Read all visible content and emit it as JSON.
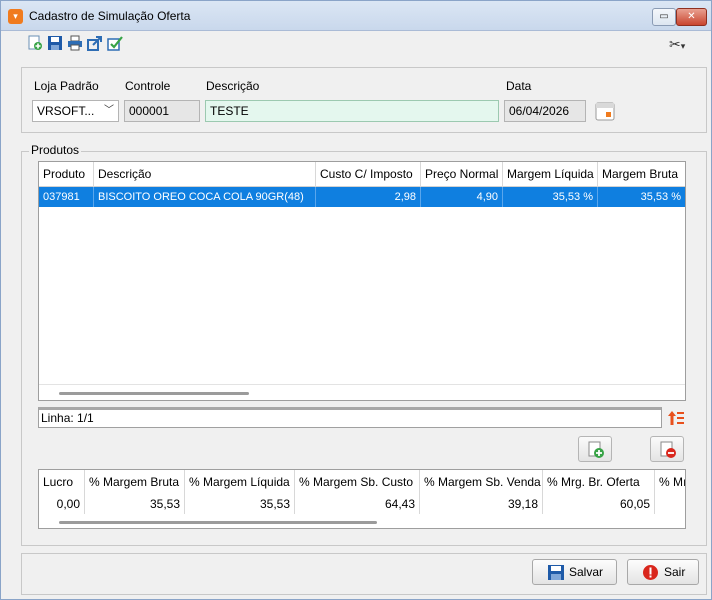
{
  "window": {
    "title": "Cadastro de Simulação Oferta",
    "restore_icon": "restore-icon",
    "close_icon": "close-icon"
  },
  "toolbar": {
    "icons": [
      "new-icon",
      "save-icon",
      "print-icon",
      "export-icon",
      "approve-icon"
    ],
    "tools_icon": "tools-icon"
  },
  "header": {
    "loja_label": "Loja Padrão",
    "loja_value": "VRSOFT...",
    "controle_label": "Controle",
    "controle_value": "000001",
    "descricao_label": "Descrição",
    "descricao_value": "TESTE",
    "data_label": "Data",
    "data_value": "06/04/2026"
  },
  "produtos": {
    "section_label": "Produtos",
    "columns": [
      "Produto",
      "Descrição",
      "Custo C/ Imposto",
      "Preço Normal",
      "Margem Líquida",
      "Margem Bruta"
    ],
    "rows": [
      [
        "037981",
        "BISCOITO OREO COCA COLA 90GR(48)",
        "2,98",
        "4,90",
        "35,53 %",
        "35,53 %"
      ]
    ],
    "linha": "Linha: 1/1"
  },
  "resumo": {
    "columns": [
      "Lucro",
      "% Margem Bruta",
      "% Margem Líquida",
      "% Margem Sb. Custo",
      "% Margem Sb. Venda",
      "% Mrg. Br. Oferta",
      "% Mı"
    ],
    "values": [
      "0,00",
      "35,53",
      "35,53",
      "64,43",
      "39,18",
      "60,05",
      ""
    ]
  },
  "buttons": {
    "salvar": "Salvar",
    "sair": "Sair"
  },
  "colors": {
    "selection": "#0f7fe0",
    "accent_orange": "#f07b1e",
    "field_green": "#e4f7ee"
  }
}
